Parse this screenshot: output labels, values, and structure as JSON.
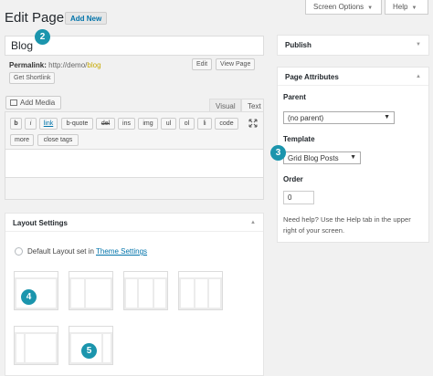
{
  "header": {
    "screen_options": "Screen Options",
    "help": "Help",
    "page_title": "Edit Page",
    "add_new": "Add New"
  },
  "post": {
    "title_value": "Blog",
    "permalink_label": "Permalink:",
    "permalink_base": "http://demo/",
    "permalink_slug": "blog",
    "edit_btn": "Edit",
    "view_page_btn": "View Page",
    "get_shortlink_btn": "Get Shortlink"
  },
  "editor": {
    "add_media": "Add Media",
    "tab_visual": "Visual",
    "tab_text": "Text",
    "quicktags": [
      "b",
      "i",
      "link",
      "b-quote",
      "del",
      "ins",
      "img",
      "ul",
      "ol",
      "li",
      "code",
      "more",
      "close tags"
    ]
  },
  "layout_settings": {
    "title": "Layout Settings",
    "default_label": "Default Layout set in",
    "default_link": "Theme Settings"
  },
  "publish": {
    "title": "Publish"
  },
  "page_attributes": {
    "title": "Page Attributes",
    "parent_label": "Parent",
    "parent_value": "(no parent)",
    "template_label": "Template",
    "template_value": "Grid Blog Posts",
    "order_label": "Order",
    "order_value": "0",
    "help_line1": "Need help? Use the Help tab in the upper",
    "help_line2": "right of your screen."
  },
  "badges": [
    "2",
    "3",
    "4",
    "5"
  ],
  "icons": {
    "dropdown": "caret-down-icon",
    "toggle": "triangle-toggle-icon",
    "fullscreen": "fullscreen-icon",
    "media": "media-icon"
  },
  "colors": {
    "accent": "#1b95ad",
    "link": "#0073aa",
    "slug": "#c6a800"
  }
}
